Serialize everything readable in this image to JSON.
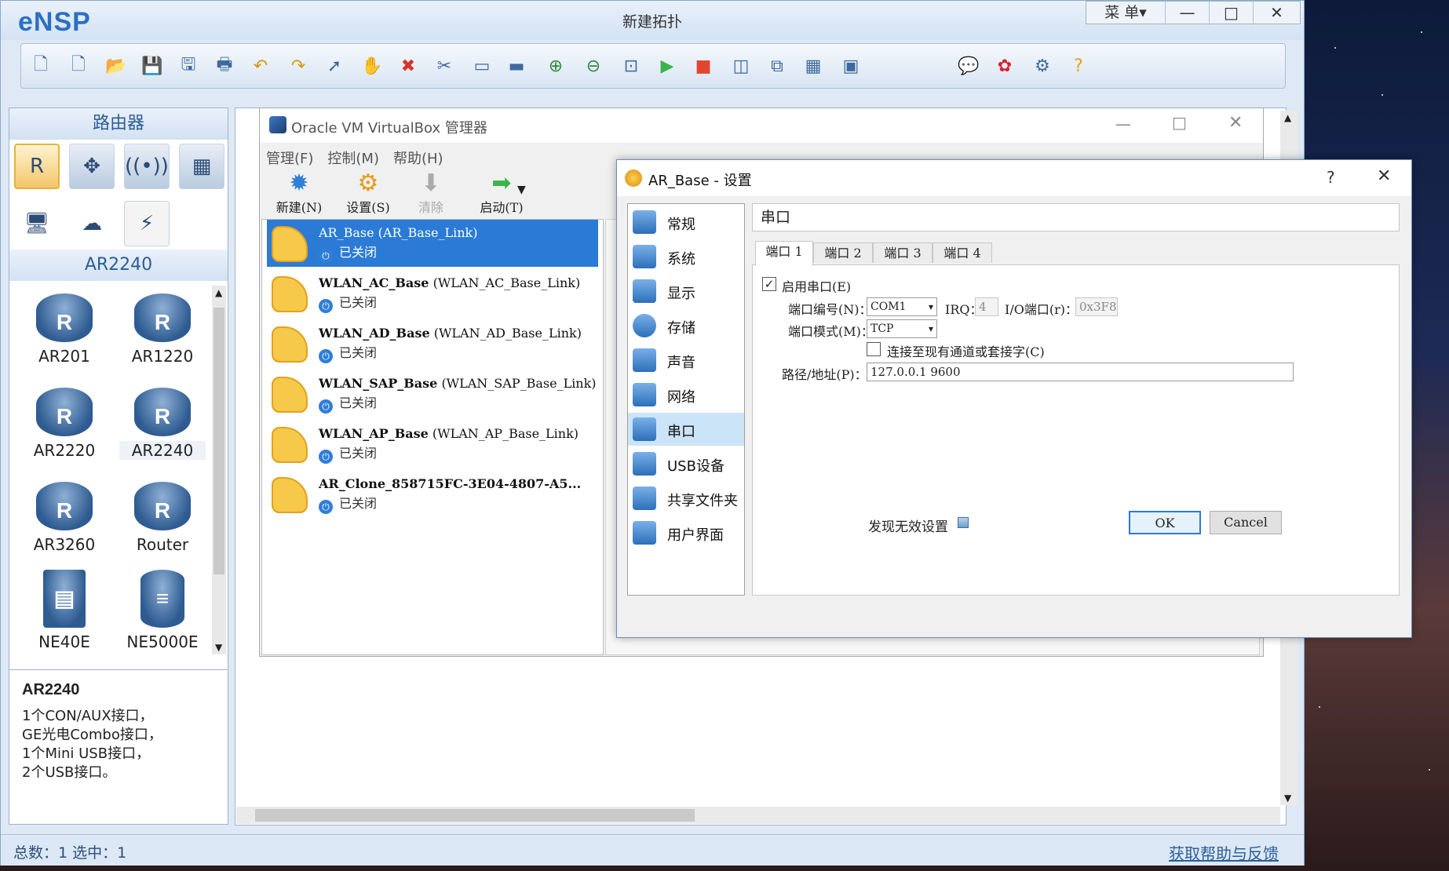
{
  "ensp": {
    "logo": "eNSP",
    "window_title": "新建拓扑",
    "menu_label": "菜 单▾",
    "toolbar_icons": [
      "new-topology-icon",
      "new-example-icon",
      "open-icon",
      "save-icon",
      "save-as-icon",
      "print-icon",
      "undo-icon",
      "redo-icon",
      "select-icon",
      "pan-icon",
      "delete-icon",
      "delete-link-icon",
      "text-icon",
      "rectangle-icon",
      "zoom-in-icon",
      "zoom-out-icon",
      "fit-icon",
      "start-all-icon",
      "stop-all-icon",
      "capture-icon",
      "topology-icon",
      "grid-icon",
      "terminal-icon",
      "chat-icon",
      "huawei-icon",
      "settings-icon",
      "help-icon"
    ],
    "left_panel": {
      "category_title": "路由器",
      "selected_series": "AR2240",
      "devices": [
        "AR201",
        "AR1220",
        "AR2220",
        "AR2240",
        "AR3260",
        "Router",
        "NE40E",
        "NE5000E"
      ],
      "desc_title": "AR2240",
      "desc_lines": [
        "1个CON/AUX接口，",
        "GE光电Combo接口，",
        "1个Mini USB接口，",
        "2个USB接口。"
      ]
    },
    "status": {
      "count_text": "总数：1 选中：1",
      "help_link": "获取帮助与反馈"
    }
  },
  "vbox": {
    "title": "Oracle VM VirtualBox 管理器",
    "menu": [
      "管理(F)",
      "控制(M)",
      "帮助(H)"
    ],
    "toolbar": [
      {
        "label": "新建(N)",
        "icon": "new-star-icon"
      },
      {
        "label": "设置(S)",
        "icon": "settings-gear-icon"
      },
      {
        "label": "清除",
        "icon": "discard-arrow-icon"
      },
      {
        "label": "启动(T)",
        "icon": "start-arrow-icon"
      }
    ],
    "vms": [
      {
        "name": "AR_Base",
        "group": "(AR_Base_Link)",
        "state": "已关闭",
        "selected": true
      },
      {
        "name": "WLAN_AC_Base",
        "group": "(WLAN_AC_Base_Link)",
        "state": "已关闭"
      },
      {
        "name": "WLAN_AD_Base",
        "group": "(WLAN_AD_Base_Link)",
        "state": "已关闭"
      },
      {
        "name": "WLAN_SAP_Base",
        "group": "(WLAN_SAP_Base_Link)",
        "state": "已关闭"
      },
      {
        "name": "WLAN_AP_Base",
        "group": "(WLAN_AP_Base_Link)",
        "state": "已关闭"
      },
      {
        "name": "AR_Clone_858715FC-3E04-4807-A5...",
        "group": "",
        "state": "已关闭"
      }
    ]
  },
  "dialog": {
    "title": "AR_Base - 设置",
    "help": "?",
    "nav": [
      "常规",
      "系统",
      "显示",
      "存储",
      "声音",
      "网络",
      "串口",
      "USB设备",
      "共享文件夹",
      "用户界面"
    ],
    "selected_nav": "串口",
    "section_title": "串口",
    "tabs": [
      "端口 1",
      "端口 2",
      "端口 3",
      "端口 4"
    ],
    "enable_label": "启用串口(E)",
    "enable_checked": true,
    "port_num_label": "端口编号(N)：",
    "port_num_value": "COM1",
    "irq_label": "IRQ：",
    "irq_value": "4",
    "io_label": "I/O端口(r)：",
    "io_value": "0x3F8",
    "mode_label": "端口模式(M)：",
    "mode_value": "TCP",
    "connect_label": "连接至现有通道或套接字(C)",
    "connect_checked": false,
    "path_label": "路径/地址(P)：",
    "path_value": "127.0.0.1 9600",
    "invalid_text": "发现无效设置",
    "ok": "OK",
    "cancel": "Cancel"
  }
}
